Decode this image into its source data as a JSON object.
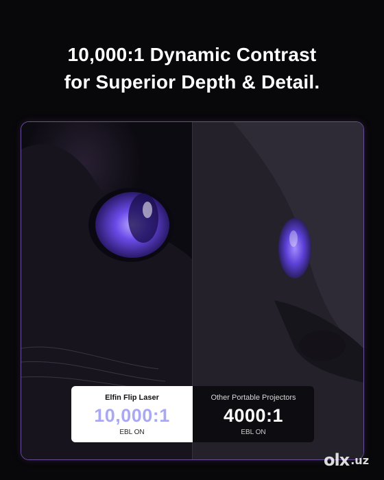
{
  "headline": {
    "line1": "10,000:1 Dynamic Contrast",
    "line2": "for Superior Depth & Detail."
  },
  "comparison": {
    "left": {
      "name": "Elfin Flip Laser",
      "ratio": "10,000:1",
      "unit": "EBL ON"
    },
    "right": {
      "name": "Other Portable Projectors",
      "ratio": "4000:1",
      "unit": "EBL ON"
    }
  },
  "colors": {
    "accent_purple": "#a9a8f2",
    "frame_border": "#6a4f9a",
    "eye_violet": "#6a4be8"
  },
  "watermark": {
    "logo": "olx",
    "tld": ".uz"
  }
}
